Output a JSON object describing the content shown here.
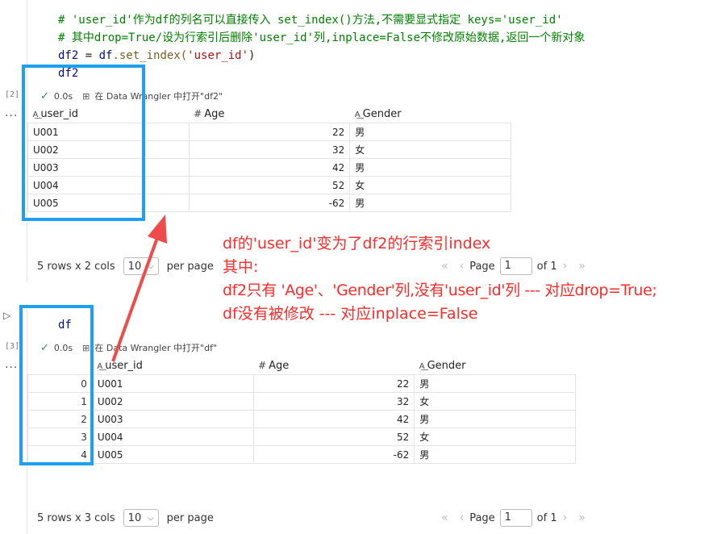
{
  "cell1": {
    "code_comment1": "# 'user_id'作为df的列名可以直接传入 set_index()方法,不需要显式指定 keys='user_id'",
    "code_comment2": "# 其中drop=True/设为行索引后删除'user_id'列,inplace=False不修改原始数据,返回一个新对象",
    "code_line3_var": "df2",
    "code_line3_eq": " = ",
    "code_line3_obj": "df",
    "code_line3_fn": ".set_index(",
    "code_line3_str": "'user_id'",
    "code_line3_close": ")",
    "code_line4": "df2",
    "exec_count": "[2]",
    "time": "0.0s",
    "dw_text": "在 Data Wrangler 中打开\"df2\"",
    "headers": [
      "user_id",
      "Age",
      "Gender"
    ],
    "rows": [
      [
        "U001",
        "22",
        "男"
      ],
      [
        "U002",
        "32",
        "女"
      ],
      [
        "U003",
        "42",
        "男"
      ],
      [
        "U004",
        "52",
        "女"
      ],
      [
        "U005",
        "-62",
        "男"
      ]
    ],
    "pager": {
      "summary": "5 rows x 2 cols",
      "per_page_value": "10",
      "per_page_label": "per page",
      "page_label": "Page",
      "page_value": "1",
      "of_label": "of 1"
    }
  },
  "cell2": {
    "code_line1": "df",
    "exec_count": "[3]",
    "time": "0.0s",
    "dw_text": "在 Data Wrangler 中打开\"df\"",
    "headers": [
      "user_id",
      "Age",
      "Gender"
    ],
    "index": [
      "0",
      "1",
      "2",
      "3",
      "4"
    ],
    "rows": [
      [
        "U001",
        "22",
        "男"
      ],
      [
        "U002",
        "32",
        "女"
      ],
      [
        "U003",
        "42",
        "男"
      ],
      [
        "U004",
        "52",
        "女"
      ],
      [
        "U005",
        "-62",
        "男"
      ]
    ],
    "pager": {
      "summary": "5 rows x 3 cols",
      "per_page_value": "10",
      "per_page_label": "per page",
      "page_label": "Page",
      "page_value": "1",
      "of_label": "of 1"
    }
  },
  "annotation": {
    "line1": "df的'user_id'变为了df2的行索引index",
    "line2": "其中:",
    "line3": "df2只有 'Age'、'Gender'列,没有'user_id'列 --- 对应drop=True;",
    "line4": "df没有被修改 --- 对应inplace=False"
  },
  "icons": {
    "check": "check-icon",
    "data_wrangler": "data-wrangler-icon",
    "text_column": "text-column-icon",
    "number_column": "number-column-icon",
    "chevron": "chevron-down-icon",
    "run": "run-icon",
    "more": "more-icon"
  },
  "colors": {
    "highlight_box": "#1e9ff2",
    "annotation": "#ff2a2a",
    "arrow": "#f04b4b"
  }
}
